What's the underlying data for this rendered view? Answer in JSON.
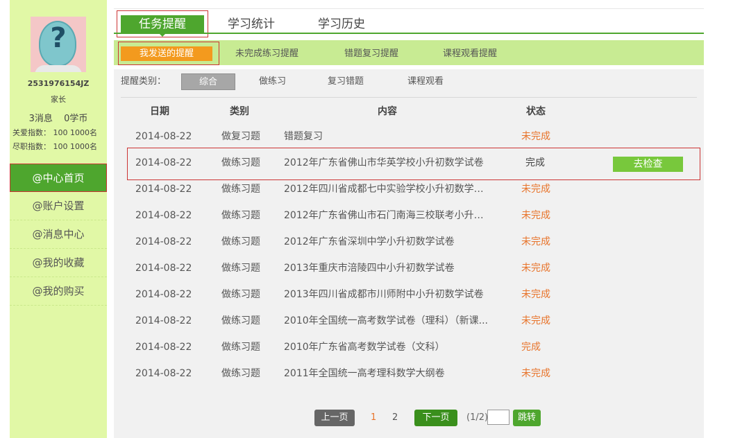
{
  "sidebar": {
    "user_id": "2531976154JZ",
    "role": "家长",
    "messages": "3消息",
    "coins": "0学币",
    "care_index": "关爱指数：  100 1000名",
    "duty_index": "尽职指数：  100 1000名",
    "nav": [
      {
        "label": "@中心首页"
      },
      {
        "label": "@账户设置"
      },
      {
        "label": "@消息中心"
      },
      {
        "label": "@我的收藏"
      },
      {
        "label": "@我的购买"
      }
    ]
  },
  "tabs": [
    {
      "label": "任务提醒"
    },
    {
      "label": "学习统计"
    },
    {
      "label": "学习历史"
    }
  ],
  "subtabs": [
    {
      "label": "我发送的提醒"
    },
    {
      "label": "未完成练习提醒"
    },
    {
      "label": "错题复习提醒"
    },
    {
      "label": "课程观看提醒"
    }
  ],
  "filter": {
    "label": "提醒类别：",
    "options": [
      {
        "label": "综合"
      },
      {
        "label": "做练习"
      },
      {
        "label": "复习错题"
      },
      {
        "label": "课程观看"
      }
    ]
  },
  "table": {
    "headers": {
      "date": "日期",
      "type": "类别",
      "content": "内容",
      "status": "状态"
    },
    "rows": [
      {
        "date": "2014-08-22",
        "type": "做复习题",
        "content": "错题复习",
        "status": "未完成"
      },
      {
        "date": "2014-08-22",
        "type": "做练习题",
        "content": "2012年广东省佛山市华英学校小升初数学试卷",
        "status": "完成",
        "action": "去检查"
      },
      {
        "date": "2014-08-22",
        "type": "做练习题",
        "content": "2012年四川省成都七中实验学校小升初数学试...",
        "status": "未完成"
      },
      {
        "date": "2014-08-22",
        "type": "做练习题",
        "content": "2012年广东省佛山市石门南海三校联考小升初...",
        "status": "未完成"
      },
      {
        "date": "2014-08-22",
        "type": "做练习题",
        "content": "2012年广东省深圳中学小升初数学试卷",
        "status": "未完成"
      },
      {
        "date": "2014-08-22",
        "type": "做练习题",
        "content": "2013年重庆市涪陵四中小升初数学试卷",
        "status": "未完成"
      },
      {
        "date": "2014-08-22",
        "type": "做练习题",
        "content": "2013年四川省成都市川师附中小升初数学试卷",
        "status": "未完成"
      },
      {
        "date": "2014-08-22",
        "type": "做练习题",
        "content": "2010年全国统一高考数学试卷（理科）（新课...",
        "status": "未完成"
      },
      {
        "date": "2014-08-22",
        "type": "做练习题",
        "content": "2010年广东省高考数学试卷（文科）",
        "status": "完成"
      },
      {
        "date": "2014-08-22",
        "type": "做练习题",
        "content": "2011年全国统一高考理科数学大纲卷",
        "status": "未完成"
      }
    ]
  },
  "pagination": {
    "prev": "上一页",
    "page1": "1",
    "page2": "2",
    "next": "下一页",
    "total": "(1/2)",
    "jump_input": "",
    "go": "跳转"
  },
  "colors": {
    "accent_green": "#4ea62e",
    "subbar_green": "#c8eb93",
    "sidebar_bg": "#e1f8a6",
    "orange": "#f39a1e",
    "status_undone": "#e8742b"
  }
}
